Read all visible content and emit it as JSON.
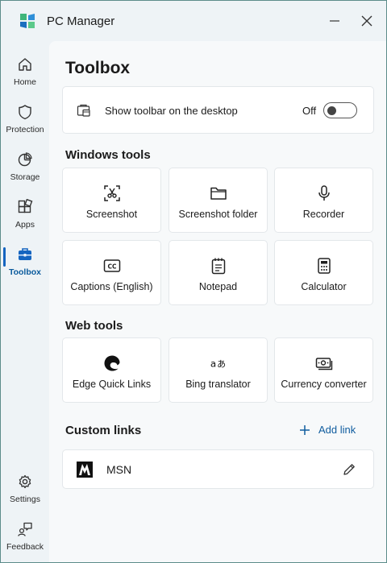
{
  "app": {
    "title": "PC Manager"
  },
  "sidebar": {
    "items": [
      {
        "label": "Home",
        "icon": "home-icon"
      },
      {
        "label": "Protection",
        "icon": "shield-icon"
      },
      {
        "label": "Storage",
        "icon": "pie-chart-icon"
      },
      {
        "label": "Apps",
        "icon": "apps-icon"
      },
      {
        "label": "Toolbox",
        "icon": "toolbox-icon",
        "active": true
      }
    ],
    "bottom_items": [
      {
        "label": "Settings",
        "icon": "gear-icon"
      },
      {
        "label": "Feedback",
        "icon": "feedback-icon"
      }
    ]
  },
  "main": {
    "title": "Toolbox",
    "toolbar_setting": {
      "label": "Show toolbar on the desktop",
      "state": "Off",
      "enabled": false
    },
    "windows_tools": {
      "title": "Windows tools",
      "items": [
        {
          "label": "Screenshot",
          "icon": "screenshot-icon"
        },
        {
          "label": "Screenshot folder",
          "icon": "folder-icon"
        },
        {
          "label": "Recorder",
          "icon": "microphone-icon"
        },
        {
          "label": "Captions (English)",
          "icon": "captions-icon"
        },
        {
          "label": "Notepad",
          "icon": "notepad-icon"
        },
        {
          "label": "Calculator",
          "icon": "calculator-icon"
        }
      ]
    },
    "web_tools": {
      "title": "Web tools",
      "items": [
        {
          "label": "Edge Quick Links",
          "icon": "edge-icon"
        },
        {
          "label": "Bing translator",
          "icon": "translator-icon"
        },
        {
          "label": "Currency converter",
          "icon": "currency-icon"
        }
      ]
    },
    "custom_links": {
      "title": "Custom links",
      "add_label": "Add link",
      "items": [
        {
          "label": "MSN",
          "icon": "msn-logo"
        }
      ]
    }
  },
  "colors": {
    "accent": "#1565c0",
    "link": "#0f5c9e",
    "window_bg": "#eef3f6",
    "content_bg": "#f7f9fa"
  }
}
